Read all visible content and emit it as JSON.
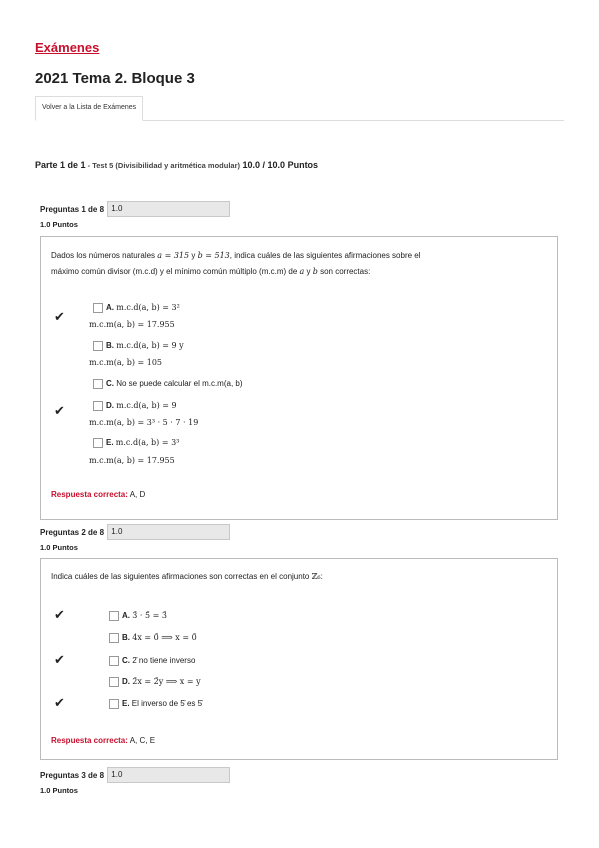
{
  "breadcrumb": "Exámenes",
  "exam_title": "2021 Tema 2. Bloque 3",
  "tab_back": "Volver a la Lista de Exámenes",
  "part": {
    "label": "Parte 1 de 1",
    "sep": " - ",
    "subtitle": "Test 5 (Divisibilidad y aritmética modular)",
    "score": " 10.0 / 10.0 Puntos"
  },
  "questions": [
    {
      "header": "Preguntas 1 de 8",
      "value": "1.0",
      "points": "1.0 Puntos",
      "prompt_a": "Dados los números naturales ",
      "prompt_b": " y ",
      "prompt_c": ", indica cuáles de las siguientes afirmaciones sobre el",
      "prompt_d": "máximo común divisor (m.c.d) y el mínimo común múltiplo (m.c.m) de ",
      "prompt_e": " y ",
      "prompt_f": " son correctas:",
      "math_a": "a = 315",
      "math_b": "b = 513",
      "var_a": "a",
      "var_b": "b",
      "options": [
        {
          "letter": "A.",
          "l1": "m.c.d(a, b) = 3²",
          "l2": "m.c.m(a, b) = 17.955",
          "correct": true
        },
        {
          "letter": "B.",
          "l1": "m.c.d(a, b) = 9 y",
          "l2": "m.c.m(a, b) = 105",
          "correct": false
        },
        {
          "letter": "C.",
          "l1": "No se puede calcular el m.c.m(a, b)",
          "l2": "",
          "correct": false
        },
        {
          "letter": "D.",
          "l1": "m.c.d(a, b) = 9",
          "l2": "m.c.m(a, b) = 3³ · 5 · 7 · 19",
          "correct": true
        },
        {
          "letter": "E.",
          "l1": "m.c.d(a, b) = 3³",
          "l2": "m.c.m(a, b) = 17.955",
          "correct": false
        }
      ],
      "answer_label": "Respuesta correcta:",
      "answer_value": " A, D"
    },
    {
      "header": "Preguntas 2 de 8",
      "value": "1.0",
      "points": "1.0 Puntos",
      "prompt": "Indica cuáles de las siguientes afirmaciones son correctas en el conjunto ",
      "set": "ℤ₆",
      "prompt_end": ":",
      "options": [
        {
          "letter": "A.",
          "text": "3̄ · 5̄ = 3̄",
          "correct": true
        },
        {
          "letter": "B.",
          "text": "4x = 0̄ ⟹ x = 0̄",
          "correct": false
        },
        {
          "letter": "C.",
          "text": "2̄ no tiene inverso",
          "correct": true
        },
        {
          "letter": "D.",
          "text": "2̄x = 2̄y ⟹ x = y",
          "correct": false
        },
        {
          "letter": "E.",
          "text": "El inverso de 5̄ es 5̄",
          "correct": true
        }
      ],
      "answer_label": "Respuesta correcta:",
      "answer_value": " A, C, E"
    },
    {
      "header": "Preguntas 3 de 8",
      "value": "1.0",
      "points": "1.0 Puntos"
    }
  ],
  "check_glyph": "✔"
}
